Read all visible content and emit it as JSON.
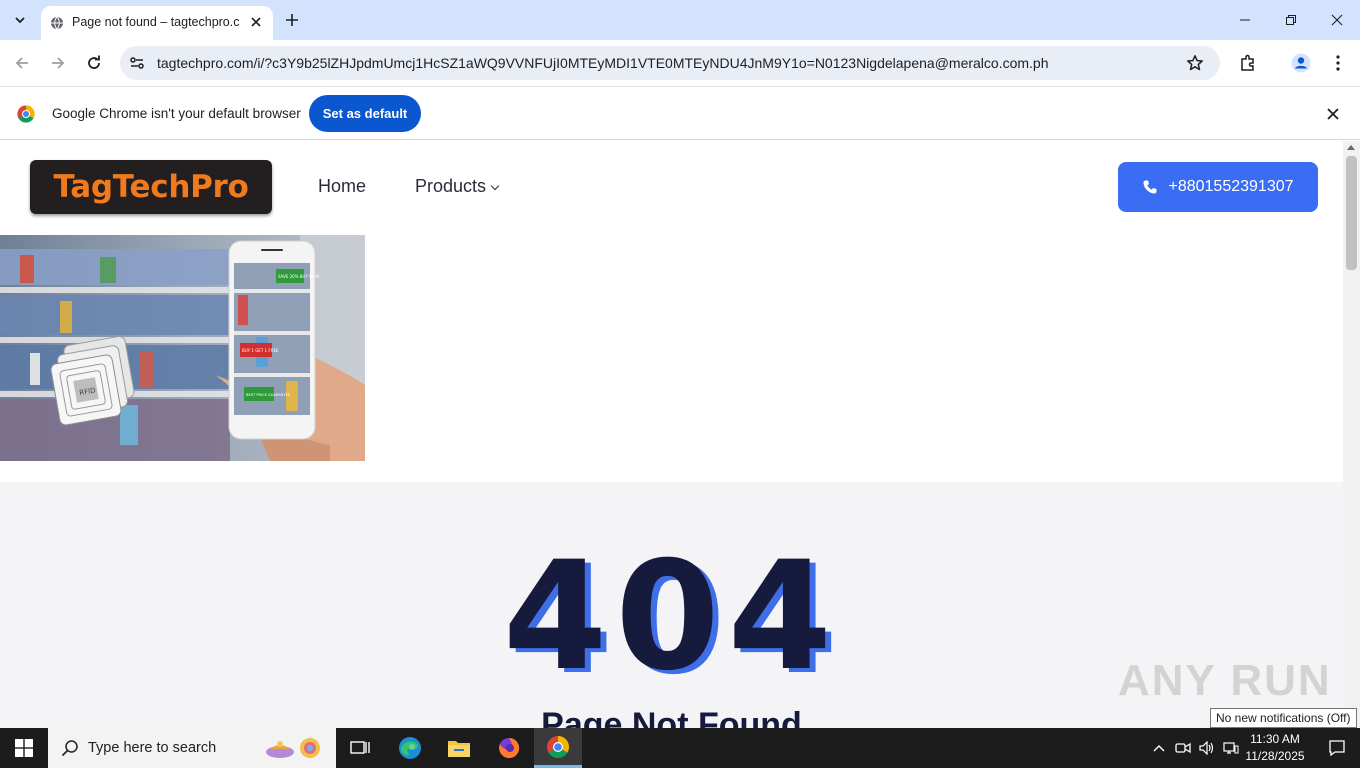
{
  "browser": {
    "tab_title": "Page not found – tagtechpro.com",
    "url": "tagtechpro.com/i/?c3Y9b25lZHJpdmUmcj1HcSZ1aWQ9VVNFUjI0MTEyMDI1VTE0MTEyNDU4JnM9Y1o=N0123Nigdelapena@meralco.com.ph"
  },
  "infobar": {
    "message": "Google Chrome isn't your default browser",
    "button_label": "Set as default"
  },
  "site": {
    "logo_text": "TagTechPro",
    "nav": {
      "home": "Home",
      "products": "Products"
    },
    "phone": "+8801552391307",
    "error_code": "404",
    "error_title": "Page Not Found"
  },
  "hero_tags": {
    "tag1": "SAVE 20% BUY NOW",
    "tag2": "BUY 1 GET 1 FREE",
    "tag3": "BEST PRICE GUARANTEE",
    "rfid": "RFID"
  },
  "watermark": "ANY RUN",
  "notification_tooltip": "No new notifications (Off)",
  "taskbar": {
    "search_placeholder": "Type here to search",
    "time": "11:30 AM",
    "date": "11/28/2025"
  },
  "colors": {
    "tabstrip_bg": "#d3e3fd",
    "set_default_blue": "#0b57d0",
    "phone_button_blue": "#3a6cf4",
    "logo_orange": "#f07a1c",
    "error_navy": "#161b3d",
    "error_shadow_blue": "#3e6fe8"
  },
  "icons": [
    "chevron-down-icon",
    "globe-icon",
    "close-icon",
    "plus-icon",
    "minimize-icon",
    "maximize-icon",
    "back-arrow-icon",
    "forward-arrow-icon",
    "reload-icon",
    "site-settings-icon",
    "star-icon",
    "extensions-icon",
    "profile-icon",
    "kebab-menu-icon",
    "chrome-logo-icon",
    "phone-icon",
    "windows-logo-icon",
    "search-icon",
    "task-view-icon",
    "edge-icon",
    "file-explorer-icon",
    "firefox-icon",
    "chrome-icon",
    "chevron-up-icon",
    "meet-icon",
    "volume-icon",
    "network-icon",
    "notification-icon"
  ]
}
